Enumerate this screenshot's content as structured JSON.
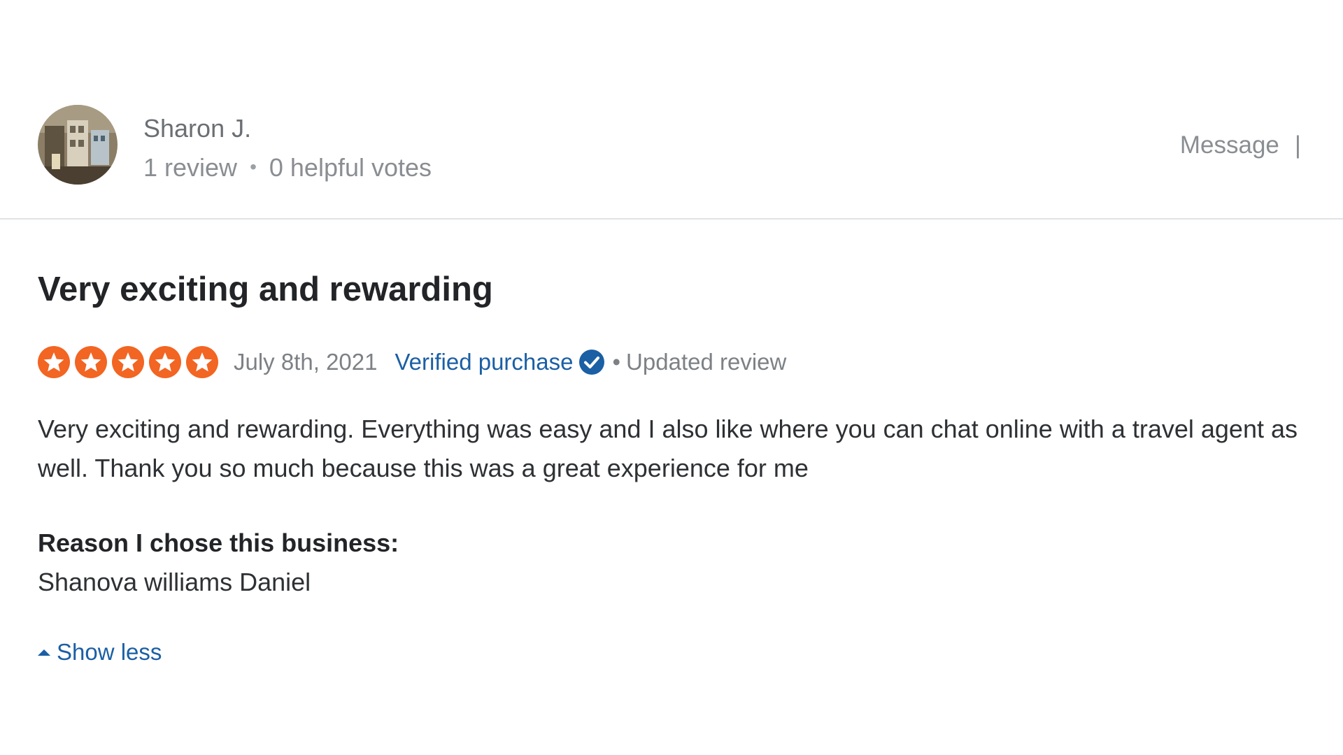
{
  "reviewer": {
    "name": "Sharon J.",
    "review_count": "1 review",
    "separator": "•",
    "helpful_votes": "0 helpful votes",
    "avatar_icon": "user-photo"
  },
  "actions": {
    "message_label": "Message",
    "separator": "|"
  },
  "review": {
    "title": "Very exciting and rewarding",
    "rating": 5,
    "rating_max": 5,
    "date": "July 8th, 2021",
    "verified_label": "Verified purchase",
    "verified_icon": "check-badge-icon",
    "status_bullet": "•",
    "status_label": "Updated review",
    "body": "Very exciting and rewarding. Everything was easy and I also like where you can chat online with a travel agent as well. Thank you so much because this was a great experience for me",
    "reason_label": "Reason I chose this business:",
    "reason_value": "Shanova williams Daniel"
  },
  "toggle": {
    "label": "Show less",
    "icon": "caret-up-icon"
  },
  "colors": {
    "star": "#f26522",
    "link": "#1b5fa4",
    "verified_badge": "#1b5fa4",
    "divider": "#dfe3e6"
  }
}
